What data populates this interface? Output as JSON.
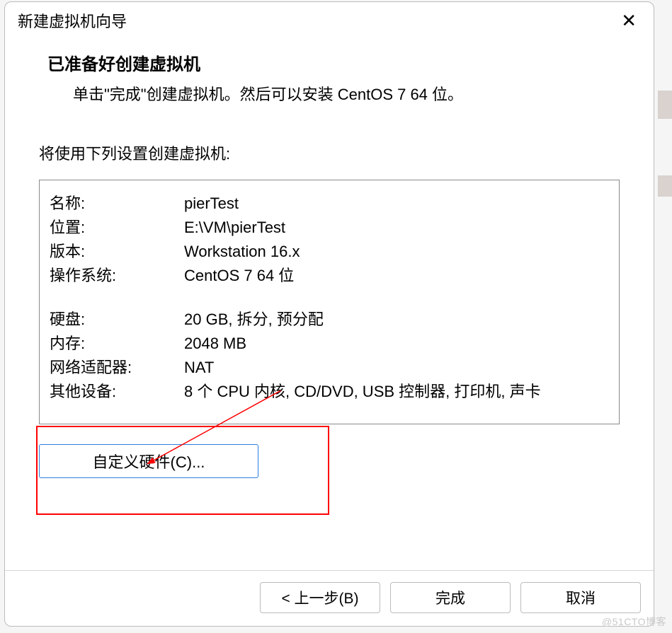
{
  "dialog": {
    "title": "新建虚拟机向导",
    "heading": "已准备好创建虚拟机",
    "subheading": "单击\"完成\"创建虚拟机。然后可以安装 CentOS 7 64 位。",
    "intro": "将使用下列设置创建虚拟机:"
  },
  "settings": {
    "group1": [
      {
        "label": "名称:",
        "value": "pierTest"
      },
      {
        "label": "位置:",
        "value": "E:\\VM\\pierTest"
      },
      {
        "label": "版本:",
        "value": "Workstation 16.x"
      },
      {
        "label": "操作系统:",
        "value": "CentOS 7 64 位"
      }
    ],
    "group2": [
      {
        "label": "硬盘:",
        "value": "20 GB, 拆分, 预分配"
      },
      {
        "label": "内存:",
        "value": "2048 MB"
      },
      {
        "label": "网络适配器:",
        "value": "NAT"
      },
      {
        "label": "其他设备:",
        "value": "8 个 CPU 内核, CD/DVD, USB 控制器, 打印机, 声卡"
      }
    ]
  },
  "buttons": {
    "customize": "自定义硬件(C)...",
    "back": "< 上一步(B)",
    "finish": "完成",
    "cancel": "取消"
  },
  "watermark": "@51CTO博客"
}
